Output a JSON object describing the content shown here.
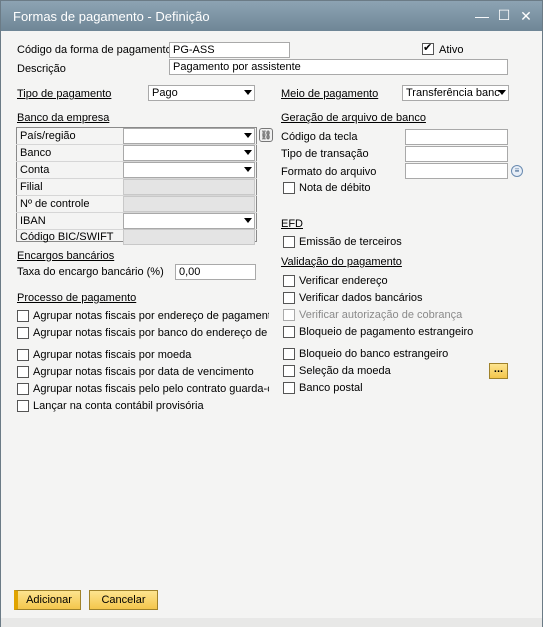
{
  "window": {
    "title": "Formas de pagamento - Definição"
  },
  "header": {
    "code_label": "Código da forma de pagamento",
    "code_value": "PG-ASS",
    "active_label": "Ativo",
    "active_checked": true,
    "desc_label": "Descrição",
    "desc_value": "Pagamento por assistente"
  },
  "payment_type": {
    "label": "Tipo de pagamento",
    "value": "Pago"
  },
  "payment_means": {
    "label": "Meio de pagamento",
    "value": "Transferência banc"
  },
  "company_bank": {
    "title": "Banco da empresa",
    "rows": [
      {
        "label": "País/região",
        "kind": "dropdown",
        "value": ""
      },
      {
        "label": "Banco",
        "kind": "dropdown",
        "value": ""
      },
      {
        "label": "Conta",
        "kind": "dropdown",
        "value": ""
      },
      {
        "label": "Filial",
        "kind": "readonly",
        "value": ""
      },
      {
        "label": "Nº de controle",
        "kind": "readonly",
        "value": ""
      },
      {
        "label": "IBAN",
        "kind": "dropdown",
        "value": ""
      },
      {
        "label": "Código BIC/SWIFT",
        "kind": "readonly",
        "value": ""
      }
    ]
  },
  "bank_file": {
    "title": "Geração de arquivo de banco",
    "key_code_label": "Código da tecla",
    "key_code_value": "",
    "trans_type_label": "Tipo de transação",
    "trans_type_value": "",
    "file_format_label": "Formato do arquivo",
    "file_format_value": "",
    "debit_note_label": "Nota de débito"
  },
  "bank_charges": {
    "title": "Encargos bancários",
    "rate_label": "Taxa do encargo bancário (%)",
    "rate_value": "0,00"
  },
  "efd": {
    "title": "EFD",
    "third_party_label": "Emissão de terceiros"
  },
  "payment_process": {
    "title": "Processo de pagamento",
    "items": [
      "Agrupar notas fiscais por endereço de pagamento",
      "Agrupar notas fiscais por banco do endereço de p",
      "Agrupar notas fiscais por moeda",
      "Agrupar notas fiscais por data de vencimento",
      "Agrupar notas fiscais pelo pelo contrato guarda-c",
      "Lançar na conta contábil provisória"
    ]
  },
  "payment_validation": {
    "title": "Validação do pagamento",
    "items": [
      "Verificar endereço",
      "Verificar dados bancários",
      "Verificar autorização de cobrança",
      "Bloqueio de pagamento estrangeiro",
      "Bloqueio do banco estrangeiro",
      "Seleção da moeda",
      "Banco postal"
    ],
    "ellipsis": "..."
  },
  "footer": {
    "add_label": "Adicionar",
    "cancel_label": "Cancelar"
  },
  "colors": {
    "titlebar": "#7b92a3",
    "button": "#f4c64c"
  }
}
